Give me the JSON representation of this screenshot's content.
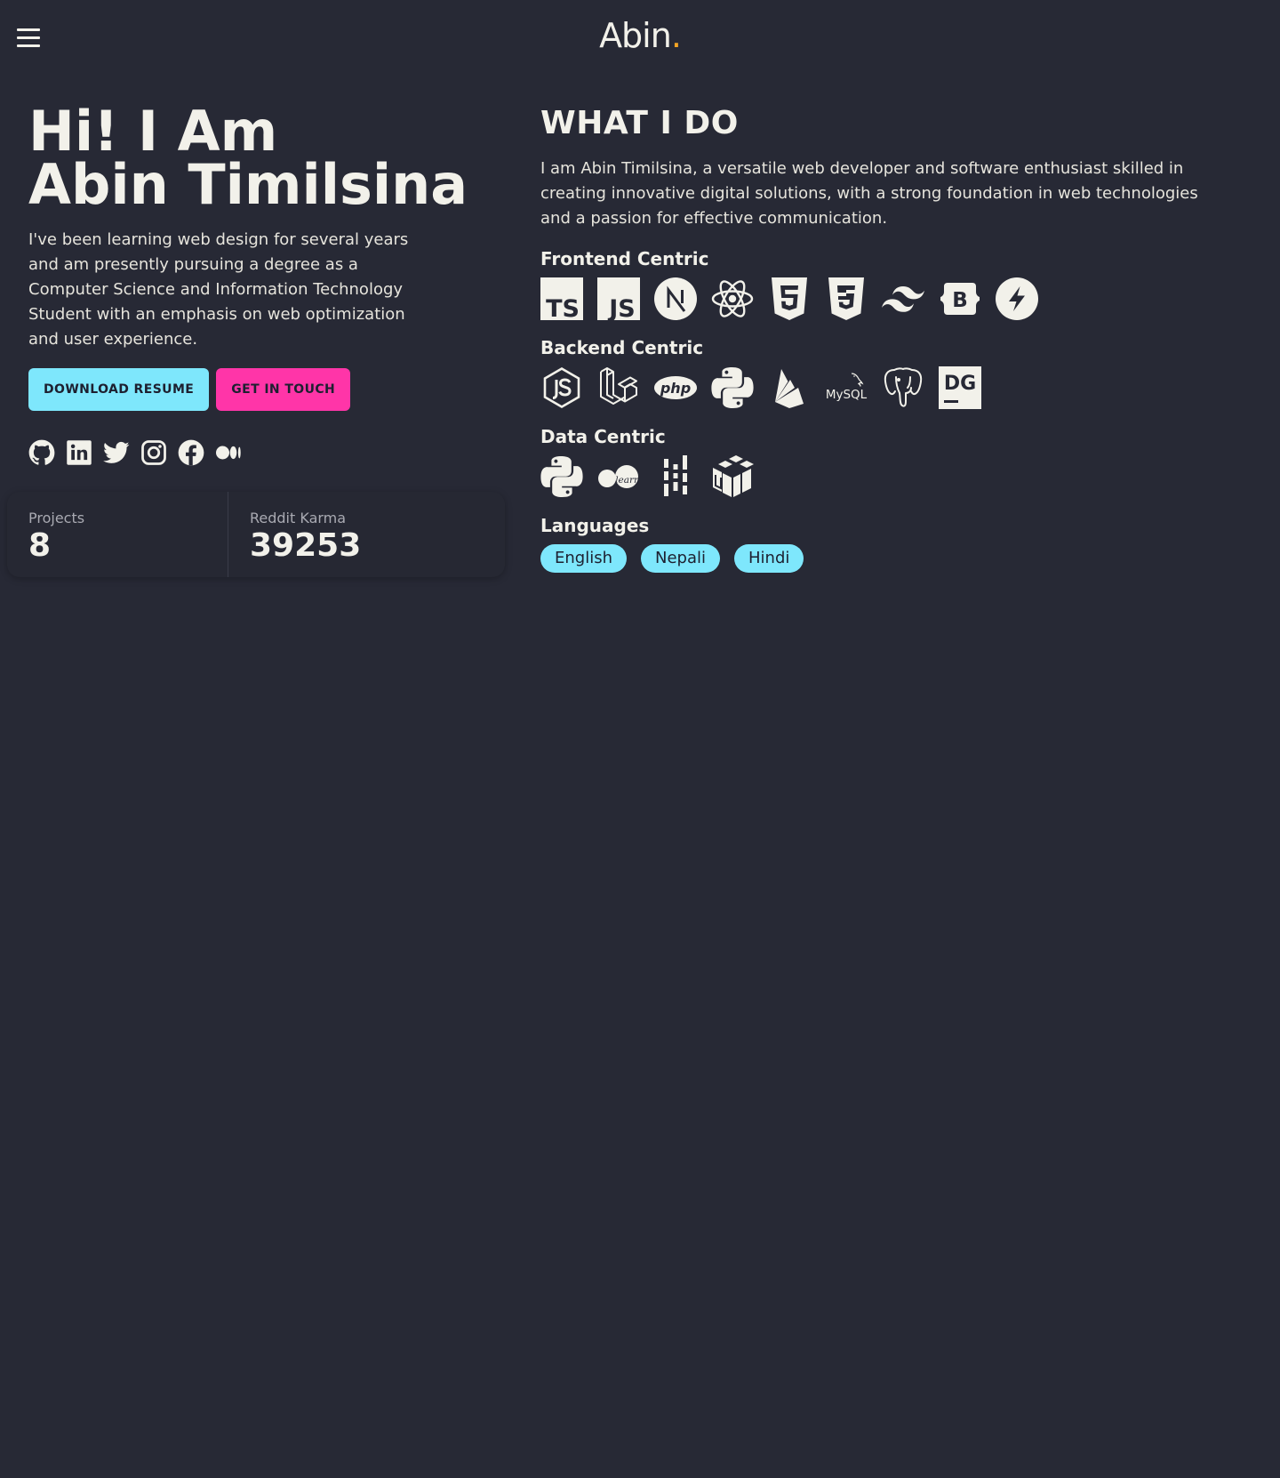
{
  "nav": {
    "brand": "Abin",
    "brand_dot": ".",
    "accent_color": "#f5a524"
  },
  "hero": {
    "title_line1": "Hi! I Am",
    "title_line2": "Abin Timilsina",
    "description": "I've been learning web design for several years and am presently pursuing a degree as a Computer Science and Information Technology Student with an emphasis on web optimization and user experience.",
    "download_label": "DOWNLOAD RESUME",
    "contact_label": "GET IN TOUCH"
  },
  "socials": [
    "github-icon",
    "linkedin-icon",
    "twitter-icon",
    "instagram-icon",
    "facebook-icon",
    "medium-icon"
  ],
  "stats": [
    {
      "label": "Projects",
      "value": "8"
    },
    {
      "label": "Reddit Karma",
      "value": "39253"
    }
  ],
  "what": {
    "title": "WHAT I DO",
    "description": "I am Abin Timilsina, a versatile web developer and software enthusiast skilled in creating innovative digital solutions, with a strong foundation in web technologies and a passion for effective communication.",
    "frontend": {
      "title": "Frontend Centric",
      "icons": [
        "typescript-icon",
        "javascript-icon",
        "nextjs-icon",
        "react-icon",
        "html5-icon",
        "css3-icon",
        "tailwind-icon",
        "bootstrap-icon",
        "fastify-icon"
      ]
    },
    "backend": {
      "title": "Backend Centric",
      "icons": [
        "nodejs-icon",
        "laravel-icon",
        "php-icon",
        "python-icon",
        "firebase-icon",
        "mysql-icon",
        "postgresql-icon",
        "datagrip-icon"
      ],
      "php_text": "php",
      "mysql_text": "MySQL",
      "datagrip_text": "DG"
    },
    "data": {
      "title": "Data Centric",
      "icons": [
        "python-icon",
        "scikit-learn-icon",
        "pandas-icon",
        "numpy-icon"
      ],
      "sklearn_text": "learn"
    },
    "languages": {
      "title": "Languages",
      "items": [
        "English",
        "Nepali",
        "Hindi"
      ]
    }
  },
  "colors": {
    "background": "#272935",
    "foreground": "#f2f1ea",
    "primary": "#7ee7fc",
    "secondary": "#ff35a8"
  }
}
